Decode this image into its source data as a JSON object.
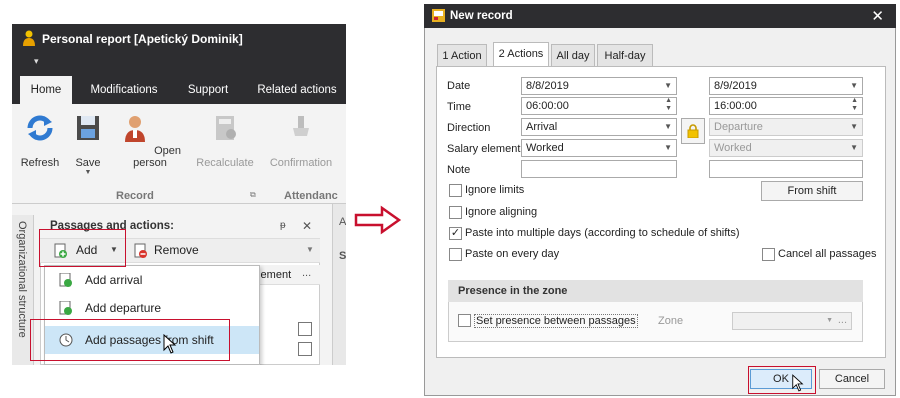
{
  "left_app": {
    "title": "Personal report [Apetický Dominik]",
    "qat": "▾",
    "tabs": [
      "Home",
      "Modifications",
      "Support",
      "Related actions"
    ],
    "ribbon_buttons": [
      {
        "label": "Refresh",
        "icon": "refresh-icon"
      },
      {
        "label": "Save",
        "icon": "save-icon"
      },
      {
        "label": "Open person",
        "icon": "person-icon"
      },
      {
        "label": "Recalculate",
        "icon": "calculator-icon"
      },
      {
        "label": "Confirmation",
        "icon": "stamp-icon"
      }
    ],
    "group_record": "Record",
    "group_attendance": "Attendanc",
    "sidebar_label": "Organizational structure",
    "panel_title": "Passages and actions:",
    "pin": "ᵽ",
    "close": "✕",
    "add_label": "Add",
    "remove_label": "Remove",
    "column_header": "element",
    "column_more": "...",
    "menu_items": [
      "Add arrival",
      "Add departure",
      "Add passages from shift"
    ],
    "behind_a": "A",
    "behind_s": "S"
  },
  "dialog": {
    "title": "New record",
    "close": "✕",
    "tabs": [
      "1 Action",
      "2 Actions",
      "All day",
      "Half-day"
    ],
    "active_tab": "2 Actions",
    "labels": {
      "date": "Date",
      "time": "Time",
      "direction": "Direction",
      "salary": "Salary element",
      "note": "Note"
    },
    "date1": "8/8/2019",
    "date2": "8/9/2019",
    "time1": "06:00:00",
    "time2": "16:00:00",
    "direction1": "Arrival",
    "direction2": "Departure",
    "salary1": "Worked",
    "salary2": "Worked",
    "from_shift": "From shift",
    "options": {
      "ignore_limits": "Ignore limits",
      "ignore_aligning": "Ignore aligning",
      "paste_multiple": "Paste into multiple days (according to schedule of shifts)",
      "paste_every": "Paste on every day",
      "cancel_all": "Cancel all passages"
    },
    "zone_section": "Presence in the zone",
    "set_presence": "Set presence between passages",
    "zone_label": "Zone",
    "zone_dots": "...",
    "ok": "OK",
    "cancel": "Cancel"
  },
  "colors": {
    "accent_red": "#c8102e",
    "title_bar": "#2d2d30",
    "highlight": "#cde6f7"
  }
}
